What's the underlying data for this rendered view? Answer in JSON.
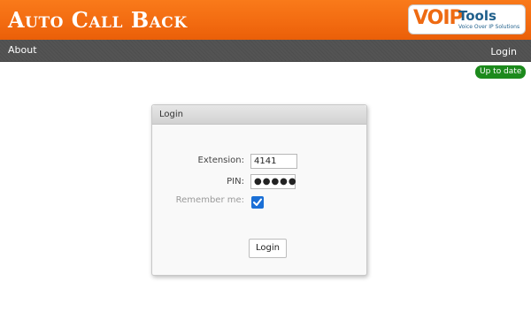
{
  "header": {
    "title": "Auto Call Back",
    "logo": {
      "voip": "VOIP",
      "tools": "Tools",
      "tagline": "Voice Over IP Solutions",
      "brand_orange": "#ee6a12",
      "brand_blue": "#1f5f8b"
    }
  },
  "nav": {
    "about_label": "About",
    "login_label": "Login"
  },
  "status": {
    "text": "Up to date",
    "color": "#1c8a1c"
  },
  "login_panel": {
    "title": "Login",
    "extension_label": "Extension:",
    "extension_value": "4141",
    "pin_label": "PIN:",
    "pin_value": "●●●●●",
    "remember_label": "Remember me:",
    "remember_checked": true,
    "submit_label": "Login"
  },
  "colors": {
    "header_orange": "#f26a10",
    "navbar_dark": "#4e4e4e",
    "checkbox_blue": "#1a6fd6"
  }
}
